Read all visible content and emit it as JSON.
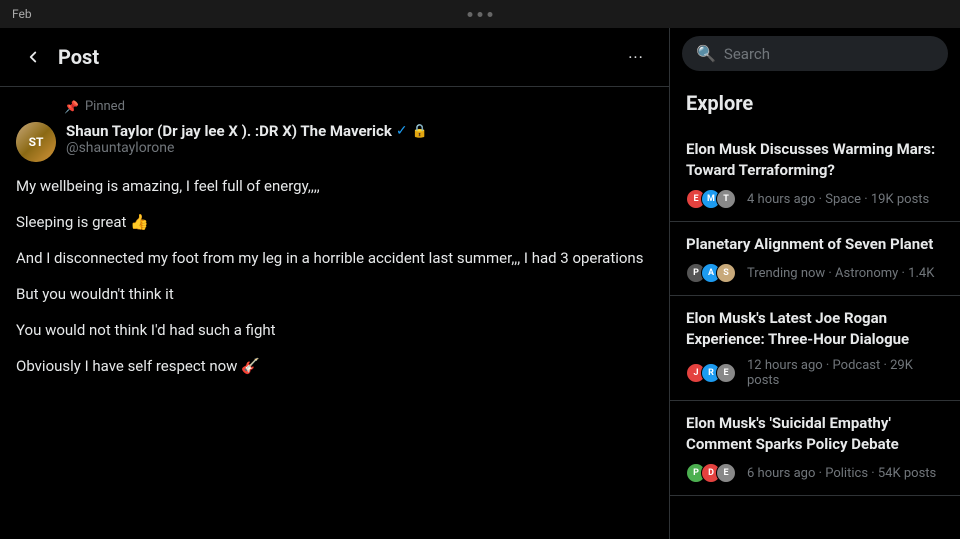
{
  "topbar": {
    "date": "Feb",
    "dots": [
      "dot1",
      "dot2",
      "dot3"
    ]
  },
  "post_panel": {
    "back_label": "←",
    "title": "Post",
    "more_label": "···",
    "pinned_label": "Pinned",
    "author": {
      "name": "Shaun Taylor (Dr jay lee X ). :DR X) The Maverick",
      "handle": "@shauntaylorone",
      "verified": true,
      "locked": true
    },
    "tweet_paragraphs": [
      "My wellbeing is amazing, I feel full of energy,,,,",
      "Sleeping is great 👍",
      "And I disconnected my foot from  my leg in a horrible accident last summer,,,\nI had 3 operations",
      "But you wouldn't think it",
      "You would not think I'd had such a fight",
      "Obviously I have self respect now 🎸"
    ]
  },
  "search": {
    "placeholder": "Search"
  },
  "explore": {
    "title": "Explore",
    "trends": [
      {
        "headline": "Elon Musk Discusses Warming Mars: Toward Terraforming?",
        "meta": "4 hours ago · Space · 19K posts",
        "avatars": [
          "E",
          "M",
          "T"
        ],
        "avatar_colors": [
          "#e4423f",
          "#1d9bf0",
          "#888"
        ]
      },
      {
        "headline": "Planetary Alignment of Seven Planet",
        "meta": "Trending now · Astronomy · 1.4K",
        "avatars": [
          "P",
          "A",
          "S"
        ],
        "avatar_colors": [
          "#555",
          "#1d9bf0",
          "#c8a97a"
        ]
      },
      {
        "headline": "Elon Musk's Latest Joe Rogan Experience: Three-Hour Dialogue",
        "meta": "12 hours ago · Podcast · 29K posts",
        "avatars": [
          "J",
          "R",
          "E"
        ],
        "avatar_colors": [
          "#e4423f",
          "#1d9bf0",
          "#888"
        ]
      },
      {
        "headline": "Elon Musk's 'Suicidal Empathy' Comment Sparks Policy Debate",
        "meta": "6 hours ago · Politics · 54K posts",
        "avatars": [
          "P",
          "D",
          "E"
        ],
        "avatar_colors": [
          "#4CAF50",
          "#e4423f",
          "#888"
        ]
      }
    ]
  }
}
